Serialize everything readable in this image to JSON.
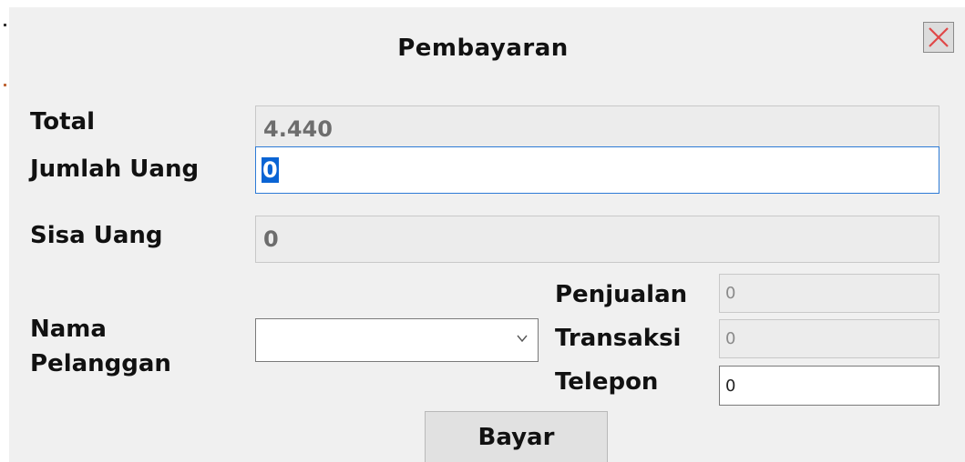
{
  "dialog": {
    "title": "Pembayaran"
  },
  "total": {
    "label": "Total",
    "value": "4.440"
  },
  "jumlah_uang": {
    "label": "Jumlah Uang",
    "value": "0"
  },
  "sisa_uang": {
    "label": "Sisa Uang",
    "value": "0"
  },
  "pelanggan": {
    "label_line1": "Nama",
    "label_line2": "Pelanggan",
    "selected": ""
  },
  "penjualan": {
    "label": "Penjualan",
    "value": "0"
  },
  "transaksi": {
    "label": "Transaksi",
    "value": "0"
  },
  "telepon": {
    "label": "Telepon",
    "value": "0"
  },
  "actions": {
    "pay_label": "Bayar"
  },
  "colors": {
    "close_x": "#e04848",
    "focus_border": "#2d7bd6",
    "selection": "#0a64d4"
  }
}
